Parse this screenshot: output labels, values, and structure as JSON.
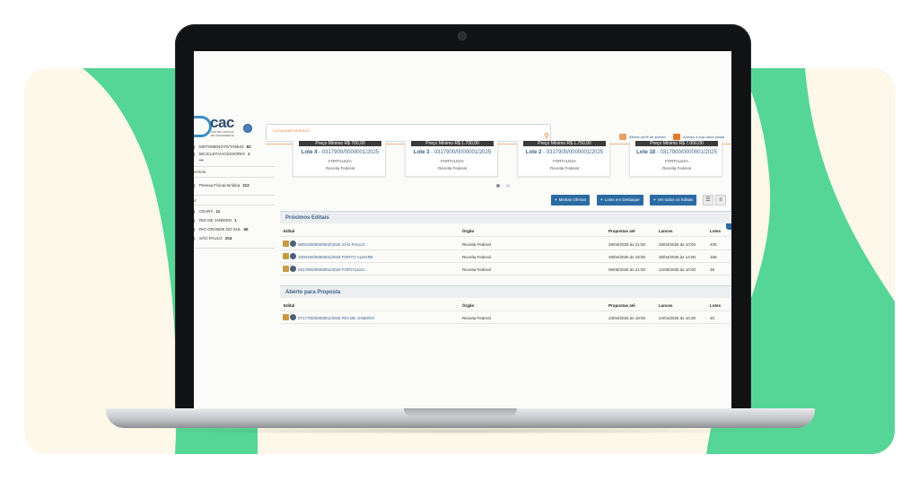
{
  "app": {
    "logo_text": "cac",
    "logo_sub": "CENTRO VIRTUAL DE ATENDIMENTO",
    "search_placeholder": "LOCALIZAR SERVIÇO",
    "header_links": [
      "Alterar perfil de acesso",
      "Acesso a sua caixa postal"
    ]
  },
  "sidebar": {
    "rows": [
      {
        "label": "MOTOMENOTIVTAMUD",
        "count": "82"
      },
      {
        "label": "BICICLETA/ACESSÓRIO",
        "count": "1"
      },
      {
        "label": "•••",
        "count": ""
      }
    ],
    "section_2": "ientela",
    "rows_2": [
      {
        "label": "Pessoa Física/Jurídica",
        "count": "312"
      }
    ],
    "section_3": "d",
    "rows_3": [
      {
        "label": "CEARÁ",
        "count": "11"
      },
      {
        "label": "RIO DE JANEIRO",
        "count": "1"
      },
      {
        "label": "RIO GRANDE DO SUL",
        "count": "66"
      },
      {
        "label": "SÃO PAULO",
        "count": "204"
      }
    ]
  },
  "lots": [
    {
      "price": "Preço Mínimo R$ 700,00",
      "lot": "Lote 4",
      "code": "- 0317900/0000001/2025",
      "city": "FORTALEZA",
      "org": "Receita Federal"
    },
    {
      "price": "Preço Mínimo R$ 1.700,00",
      "lot": "Lote 3",
      "code": "- 0317900/0000001/2025",
      "city": "FORTALEZA",
      "org": "Receita Federal"
    },
    {
      "price": "Preço Mínimo R$ 1.750,00",
      "lot": "Lote 2",
      "code": "- 0317900/0000001/2025",
      "city": "FORTALEZA",
      "org": "Receita Federal"
    },
    {
      "price": "Preço Mínimo R$ 7.000,00",
      "lot": "Lote 18",
      "code": "- 0317900/0000001/2025",
      "city": "FORTALEZA",
      "org": "Receita Federal"
    }
  ],
  "buttons": {
    "my_offers": "Minhas Ofertas",
    "featured_lots": "Lotes em Destaque",
    "all_notices": "Ver todos os Editais"
  },
  "table_headers": {
    "edital": "Edital",
    "orgao": "Órgão",
    "propostas": "Propostas até",
    "lances": "Lances",
    "lotes": "Lotes"
  },
  "proximos": {
    "title": "Próximos Editais",
    "rows": [
      {
        "edital": "0800100/0000002/2025 SÃO PAULO",
        "orgao": "Receita Federal",
        "propostas": "29/04/2025 às 21:00",
        "lances": "29/04/2025 às 10:00",
        "lotes": "400"
      },
      {
        "edital": "1000100/0000001/2025 PORTO ALEGRE",
        "orgao": "Receita Federal",
        "propostas": "29/04/2025 às 18:00",
        "lances": "29/04/2025 às 14:00",
        "lotes": "169"
      },
      {
        "edital": "0317900/0000001/2025 FORTALEZA",
        "orgao": "Receita Federal",
        "propostas": "09/05/2025 às 21:00",
        "lances": "12/05/2025 às 10:00",
        "lotes": "39"
      }
    ]
  },
  "aberto": {
    "title": "Aberto para Proposta",
    "rows": [
      {
        "edital": "0717700/0000001/2025 RIO DE JANEIRO",
        "orgao": "Receita Federal",
        "propostas": "23/04/2025 às 18:00",
        "lances": "24/04/2025 às 10:30",
        "lotes": "20"
      }
    ]
  },
  "colors": {
    "green": "#56d696",
    "cream": "#fdf8ea",
    "primary": "#2b6aa3",
    "accent": "#e07b2c"
  }
}
